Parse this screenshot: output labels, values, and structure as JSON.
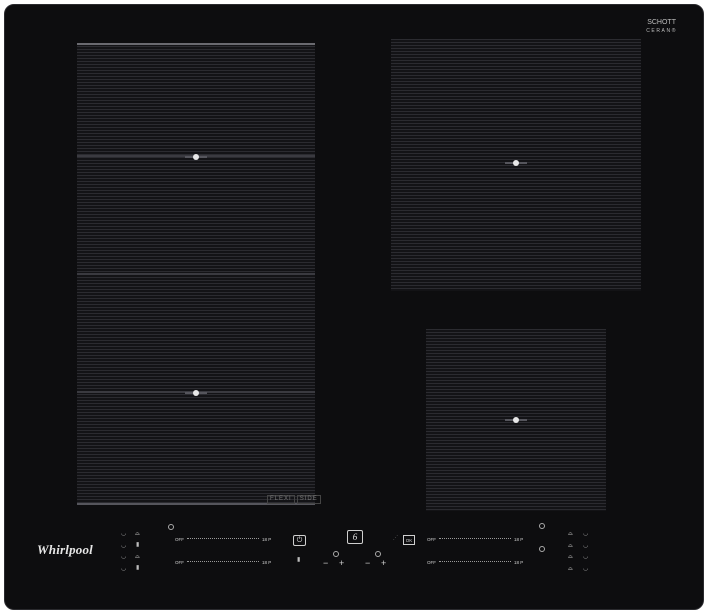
{
  "brand": {
    "logo_text": "Whirlpool",
    "glass_maker_line1": "SCHOTT",
    "glass_maker_line2": "CERAN®"
  },
  "flexi_badge": [
    "FLEXI",
    "SIDE"
  ],
  "zones": [
    {
      "id": "flexi-left",
      "name": "Flexi zone left"
    },
    {
      "id": "rear-right",
      "name": "Rear right zone"
    },
    {
      "id": "front-right",
      "name": "Front right zone"
    }
  ],
  "controls": {
    "left_sliders": [
      {
        "off_label": "OFF",
        "boost_label": "18 P"
      },
      {
        "off_label": "OFF",
        "boost_label": "18 P"
      }
    ],
    "right_sliders": [
      {
        "off_label": "OFF",
        "boost_label": "18 P"
      },
      {
        "off_label": "OFF",
        "boost_label": "18 P"
      }
    ],
    "power_symbol": "⏻",
    "sixth_sense_symbol": "6",
    "ok_label": "OK",
    "minus": "−",
    "plus": "+",
    "icons": {
      "pot": "pot-icon",
      "pan": "pan-icon",
      "lock": "lock-icon",
      "timer": "timer-icon"
    }
  }
}
